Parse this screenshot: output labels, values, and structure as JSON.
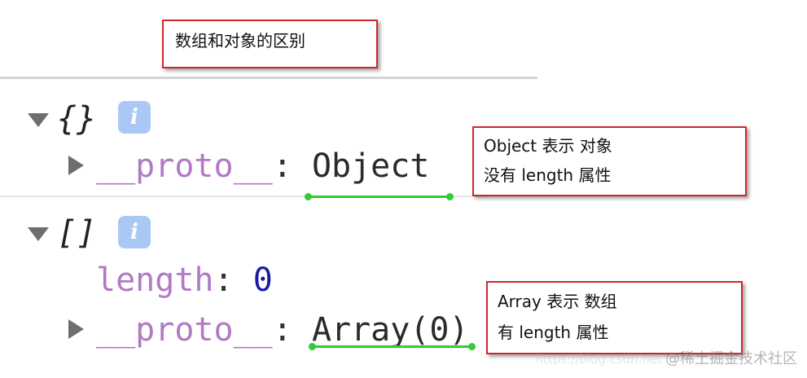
{
  "annotations": {
    "title": "数组和对象的区别",
    "object_note": [
      "Object 表示 对象",
      "没有 length 属性"
    ],
    "array_note": [
      "Array 表示 数组",
      "有 length 属性"
    ]
  },
  "console": {
    "object_entry": {
      "summary": "{}",
      "info_icon": "i",
      "proto_key": "__proto__",
      "colon": ":",
      "proto_value": "Object"
    },
    "array_entry": {
      "summary": "[]",
      "info_icon": "i",
      "length_key": "length",
      "colon": ":",
      "length_value": "0",
      "proto_key": "__proto__",
      "proto_value": "Array(0)"
    }
  },
  "watermark": {
    "text": "@稀土掘金技术社区",
    "faint_text": "https://blog.csdn.net"
  },
  "colors": {
    "annotation_border": "#d0262b",
    "highlight_underline": "#33cc33",
    "property_name": "#b07ac4",
    "number": "#1a1aa6",
    "info_badge": "#a9c8f5"
  }
}
